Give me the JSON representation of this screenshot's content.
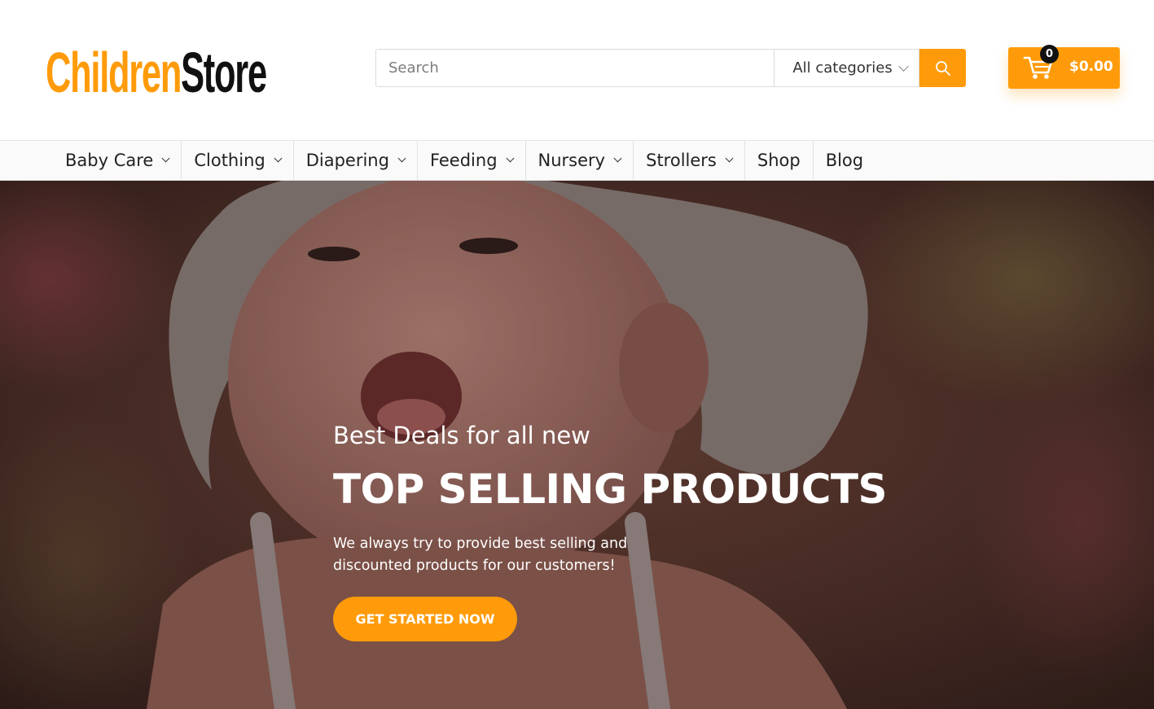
{
  "brand": {
    "logo_part_a": "Children",
    "logo_part_b": "Store",
    "accent_color": "#ff9b0a"
  },
  "search": {
    "placeholder": "Search",
    "value": "",
    "category_selected": "All categories",
    "button_icon": "search-icon"
  },
  "cart": {
    "count": "0",
    "total": "$0.00",
    "icon": "cart-icon"
  },
  "nav": {
    "items": [
      {
        "label": "Baby Care",
        "has_dropdown": true
      },
      {
        "label": "Clothing",
        "has_dropdown": true
      },
      {
        "label": "Diapering",
        "has_dropdown": true
      },
      {
        "label": "Feeding",
        "has_dropdown": true
      },
      {
        "label": "Nursery",
        "has_dropdown": true
      },
      {
        "label": "Strollers",
        "has_dropdown": true
      },
      {
        "label": "Shop",
        "has_dropdown": false
      },
      {
        "label": "Blog",
        "has_dropdown": false
      }
    ]
  },
  "hero": {
    "kicker": "Best Deals for all new",
    "title": "TOP SELLING PRODUCTS",
    "description": "We always try to provide best selling and discounted products for our customers!",
    "cta_label": "GET STARTED NOW"
  }
}
